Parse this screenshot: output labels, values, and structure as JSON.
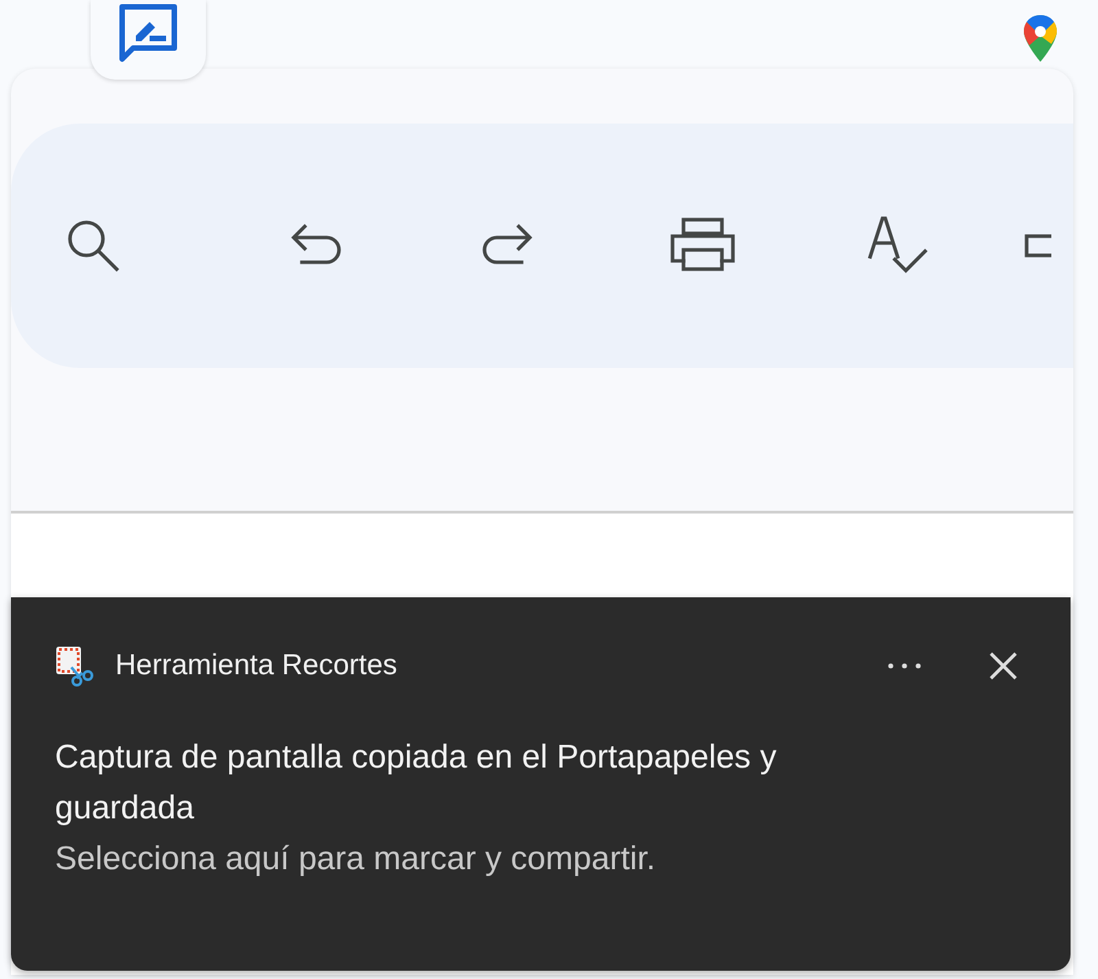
{
  "notification": {
    "app": "Herramienta Recortes",
    "message": "Captura de pantalla copiada en el Portapapeles y guardada",
    "hint": "Selecciona aquí para marcar y compartir."
  }
}
